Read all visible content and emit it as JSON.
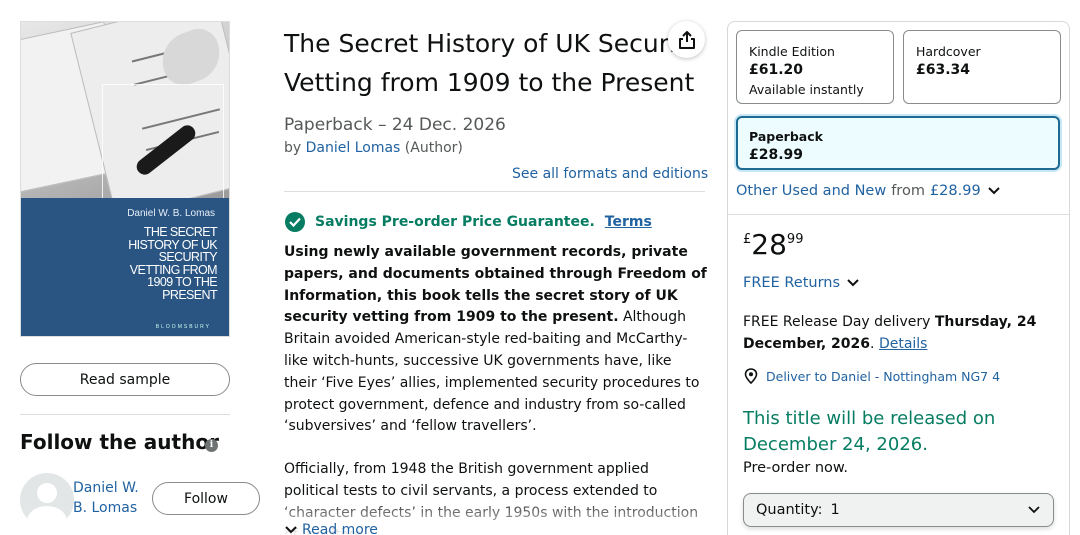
{
  "book": {
    "title": "The Secret History of UK Security Vetting from 1909 to the Present",
    "format_date": "Paperback – 24 Dec. 2026",
    "by": "by",
    "author": "Daniel Lomas",
    "author_role": "(Author)",
    "see_all_formats": "See all formats and editions"
  },
  "cover": {
    "author": "Daniel W. B. Lomas",
    "title": "THE SECRET HISTORY OF UK SECURITY VETTING FROM 1909 TO THE PRESENT",
    "publisher": "BLOOMSBURY"
  },
  "left": {
    "read_sample": "Read sample",
    "follow_title": "Follow the author",
    "info_icon": "i",
    "author_name": "Daniel W. B. Lomas",
    "follow_button": "Follow"
  },
  "guarantee": {
    "text": "Savings Pre-order Price Guarantee.",
    "terms": "Terms"
  },
  "description": {
    "bold": "Using newly available government records, private papers, and documents obtained through Freedom of Information, this book tells the secret story of UK security vetting from 1909 to the present.",
    "rest": " Although Britain avoided American-style red-baiting and McCarthy-like witch-hunts, successive UK governments have, like their ‘Five Eyes’ allies, implemented security procedures to protect government, defence and industry from so-called ‘subversives’ and ‘fellow travellers’.",
    "para2": "Officially, from 1948 the British government applied political tests to civil servants, a process extended to ‘character defects’ in the early 1950s with the introduction of ‘positive",
    "read_more": "Read more"
  },
  "formats": [
    {
      "name": "Kindle Edition",
      "price": "£61.20",
      "note": "Available instantly"
    },
    {
      "name": "Hardcover",
      "price": "£63.34"
    },
    {
      "name": "Paperback",
      "price": "£28.99"
    }
  ],
  "buybox": {
    "other_used_prefix": "Other Used and New",
    "other_used_from": "from",
    "other_used_price": "£28.99",
    "price_symbol": "£",
    "price_whole": "28",
    "price_fraction": "99",
    "returns": "FREE Returns",
    "delivery_prefix": "FREE Release Day delivery",
    "delivery_date": "Thursday, 24 December, 2026",
    "delivery_details": "Details",
    "deliver_to": "Deliver to Daniel - Nottingham NG7 4",
    "release_message": "This title will be released on December 24, 2026.",
    "preorder": "Pre-order now.",
    "quantity_label": "Quantity:",
    "quantity_value": "1"
  },
  "colors": {
    "link": "#2162a1",
    "success": "#067d62",
    "selected_border": "#1d6b94",
    "cover_blue": "#2a5583"
  },
  "icons": [
    "share-icon",
    "check-circle-icon",
    "info-icon",
    "chevron-down-icon",
    "location-pin-icon",
    "avatar-icon"
  ]
}
